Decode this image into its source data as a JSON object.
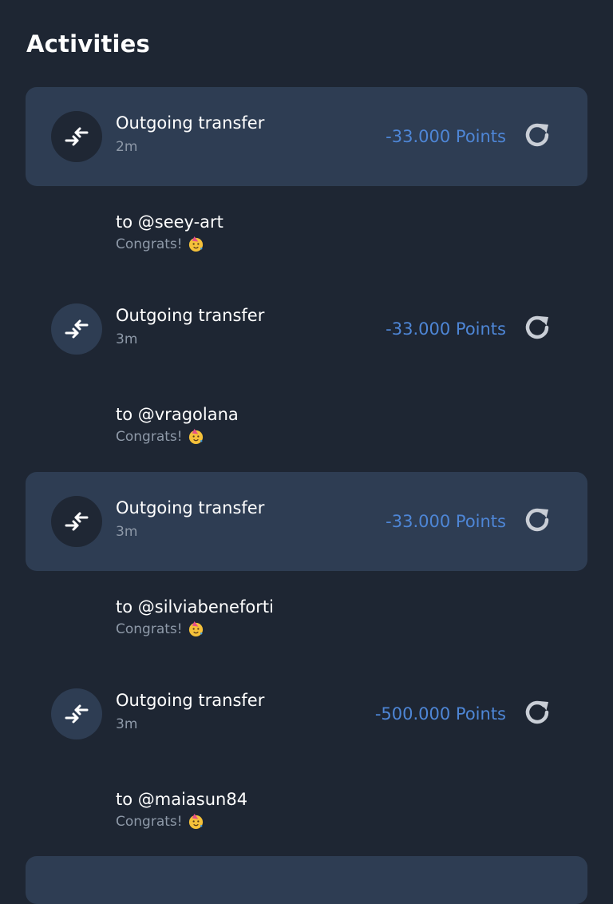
{
  "header": {
    "title": "Activities"
  },
  "activities": [
    {
      "title": "Outgoing transfer",
      "time": "2m",
      "amount": "-33.000 Points",
      "recipient": "to @seey-art",
      "memo": "Congrats!",
      "memo_emoji": "partying-face"
    },
    {
      "title": "Outgoing transfer",
      "time": "3m",
      "amount": "-33.000 Points",
      "recipient": "to @vragolana",
      "memo": "Congrats!",
      "memo_emoji": "partying-face"
    },
    {
      "title": "Outgoing transfer",
      "time": "3m",
      "amount": "-33.000 Points",
      "recipient": "to @silviabeneforti",
      "memo": "Congrats!",
      "memo_emoji": "partying-face"
    },
    {
      "title": "Outgoing transfer",
      "time": "3m",
      "amount": "-500.000 Points",
      "recipient": "to @maiasun84",
      "memo": "Congrats!",
      "memo_emoji": "partying-face"
    }
  ],
  "colors": {
    "background": "#1e2633",
    "highlight_card": "#2e3d53",
    "amount": "#4e86d6",
    "muted_text": "#8e99a8"
  },
  "icons": {
    "transfer": "transfer-arrows-icon",
    "refresh": "refresh-icon"
  }
}
